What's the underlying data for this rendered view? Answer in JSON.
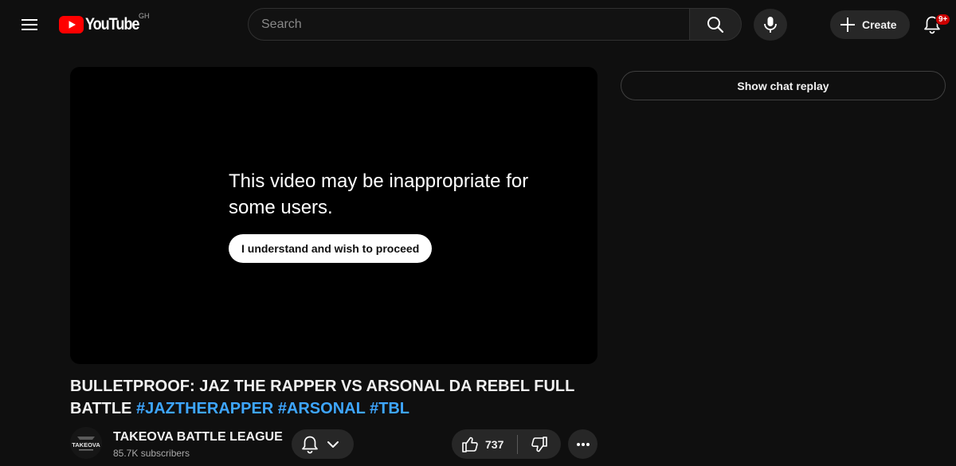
{
  "masthead": {
    "logo_text": "YouTube",
    "country_code": "GH",
    "search_placeholder": "Search",
    "search_value": "",
    "create_label": "Create",
    "notification_count": "9+"
  },
  "player": {
    "warning_text": "This video may be inappropriate for some users.",
    "proceed_label": "I understand and wish to proceed"
  },
  "chat": {
    "replay_label": "Show chat replay"
  },
  "video": {
    "title": "BULLETPROOF: JAZ THE RAPPER VS ARSONAL DA REBEL FULL BATTLE",
    "hashtags": [
      "#JAZTHERAPPER",
      "#ARSONAL",
      "#TBL"
    ]
  },
  "channel": {
    "name": "TAKEOVA BATTLE LEAGUE",
    "subscribers": "85.7K subscribers",
    "avatar_text": "TAKEOVA"
  },
  "actions": {
    "like_count": "737"
  },
  "colors": {
    "background": "#0f0f0f",
    "brand_red": "#ff0000",
    "hashtag_blue": "#3ea6ff",
    "button_bg": "#272727",
    "badge_red": "#cc0000"
  },
  "icons": {
    "menu": "hamburger-icon",
    "search": "search-icon",
    "mic": "mic-icon",
    "create": "plus-icon",
    "notifications": "bell-icon",
    "subscribe": "bell-icon",
    "subscribe_dropdown": "chevron-down-icon",
    "like": "thumbs-up-icon",
    "dislike": "thumbs-down-icon",
    "more": "more-horizontal-icon"
  }
}
